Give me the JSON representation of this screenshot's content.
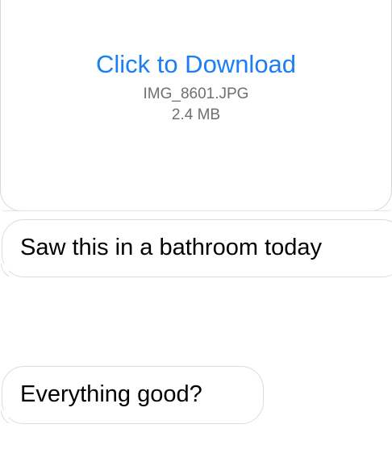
{
  "attachment": {
    "download_label": "Click to Download",
    "file_name": "IMG_8601.JPG",
    "file_size": "2.4 MB",
    "link_color": "#1a7ff5"
  },
  "messages": [
    {
      "text": "Saw this in a bathroom today"
    },
    {
      "text": "Everything good?"
    }
  ]
}
